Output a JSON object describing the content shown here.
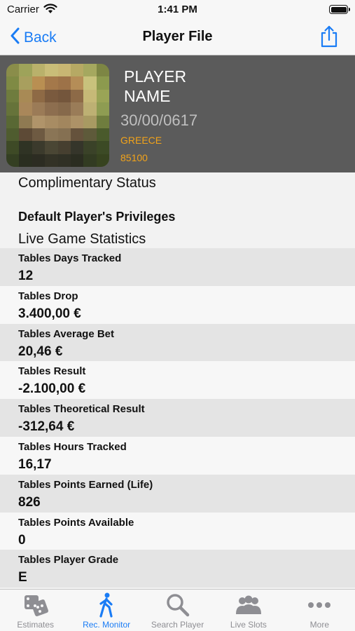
{
  "status_bar": {
    "carrier": "Carrier",
    "time": "1:41 PM"
  },
  "nav": {
    "back_label": "Back",
    "title": "Player File",
    "share_icon": "share-icon"
  },
  "player": {
    "name_line1": "PLAYER",
    "name_line2": "NAME",
    "date": "30/00/0617",
    "country": "GREECE",
    "code": "85100"
  },
  "sections": {
    "complimentary": "Complimentary Status",
    "privileges": "Default Player's Privileges",
    "live_stats": "Live Game Statistics"
  },
  "stats": [
    {
      "label": "Tables Days Tracked",
      "value": "12"
    },
    {
      "label": "Tables Drop",
      "value": "3.400,00 €"
    },
    {
      "label": "Tables Average Bet",
      "value": "20,46 €"
    },
    {
      "label": "Tables Result",
      "value": "-2.100,00 €"
    },
    {
      "label": "Tables Theoretical Result",
      "value": "-312,64 €"
    },
    {
      "label": "Tables Hours Tracked",
      "value": "16,17"
    },
    {
      "label": "Tables Points Earned (Life)",
      "value": "826"
    },
    {
      "label": "Tables Points Available",
      "value": "0"
    },
    {
      "label": "Tables Player Grade",
      "value": "E"
    }
  ],
  "tabs": [
    {
      "label": "Estimates",
      "icon": "dice-icon",
      "active": false
    },
    {
      "label": "Rec. Monitor",
      "icon": "walking-person-icon",
      "active": true
    },
    {
      "label": "Search Player",
      "icon": "magnifier-icon",
      "active": false
    },
    {
      "label": "Live Slots",
      "icon": "people-icon",
      "active": false
    },
    {
      "label": "More",
      "icon": "more-dots-icon",
      "active": false
    }
  ],
  "colors": {
    "accent": "#1a7cf5",
    "header_bg": "#5b5b5b",
    "highlight": "#f2a31a"
  }
}
